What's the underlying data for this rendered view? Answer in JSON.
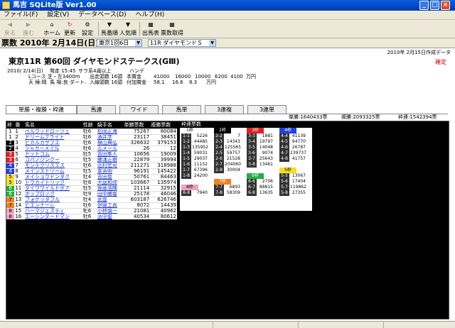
{
  "window": {
    "title": "馬吉 SQLite版 Ver1.00",
    "min": "_",
    "max": "□",
    "close": "×"
  },
  "menu": [
    "ファイル(F)",
    "設定(V)",
    "データベース(D)",
    "ヘルプ(H)"
  ],
  "toolbar": {
    "back": "戻る",
    "forward": "進む",
    "home": "ホーム",
    "refresh": "更新",
    "settings": "設定",
    "sort_horse": "馬番順",
    "sort_pop": "人気順",
    "entry_table": "出馬表",
    "odds": "票数取得"
  },
  "datebar": {
    "label": "票数 2010年 2月14日(日)",
    "venue": "東京1回6日",
    "race": "11R ダイヤモンドＳ"
  },
  "race": {
    "created": "2010年 2月15日作成データ",
    "title": "東京11R 第60回 ダイヤモンドステークス(GⅢ)",
    "status": "確定",
    "info1": [
      "2010/ 2/14(日)",
      "発走 15:45",
      "サラ系4歳以上",
      "ハンデ"
    ],
    "info2": [
      "Lコース 芝・左3400m",
      "出走頭数 16頭",
      "本賞金",
      "41000",
      "16000",
      "10000",
      "6200",
      "4100",
      "万円"
    ],
    "info3": [
      "天 候:晴",
      "馬 場:良",
      "ダート:",
      "入線頭数 16頭",
      "付加賞金",
      "58.1",
      "16.6",
      "8.3",
      "万円"
    ]
  },
  "tabs": [
    "単勝・複勝・枠連",
    "馬連",
    "ワイド",
    "馬単",
    "3連複",
    "3連単"
  ],
  "totals": {
    "tan": "単勝:1640433票",
    "fuku": "複勝:2093325票",
    "waku": "枠連:1542394票"
  },
  "horse_headers": [
    "枠",
    "番",
    "馬名",
    "性齢",
    "騎手名",
    "単勝票数",
    "複勝票数"
  ],
  "horses": [
    {
      "waku": "1",
      "num": "1",
      "name": "ベルウッドローツェ",
      "sex": "牡6",
      "jockey": "松岡正海",
      "tan": "75267",
      "fuku": "80084",
      "color": "#ffffff",
      "fg": "#000"
    },
    {
      "waku": "1",
      "num": "2",
      "name": "ドリームフライト",
      "sex": "牡6",
      "jockey": "酒井学",
      "tan": "23117",
      "fuku": "38451",
      "color": "#ffffff",
      "fg": "#000"
    },
    {
      "waku": "2",
      "num": "3",
      "name": "ヒカルカザブエ",
      "sex": "牡6",
      "jockey": "横山典弘",
      "tan": "326632",
      "fuku": "379153",
      "color": "#000000",
      "fg": "#fff"
    },
    {
      "waku": "2",
      "num": "4",
      "name": "ジャガーメイル",
      "sex": "牡6",
      "jockey": "ルメール",
      "tan": "26",
      "fuku": "12",
      "color": "#000000",
      "fg": "#fff"
    },
    {
      "waku": "3",
      "num": "5",
      "name": "ドットコム",
      "sex": "牡5",
      "jockey": "吉田隼人",
      "tan": "10656",
      "fuku": "19009",
      "color": "#e02020",
      "fg": "#fff"
    },
    {
      "waku": "3",
      "num": "6",
      "name": "コパノジングー",
      "sex": "牡5",
      "jockey": "勝浦正樹",
      "tan": "22879",
      "fuku": "39994",
      "color": "#e02020",
      "fg": "#fff"
    },
    {
      "waku": "4",
      "num": "7",
      "name": "モンテクリスエス",
      "sex": "牡6",
      "jockey": "北村宏司",
      "tan": "211271",
      "fuku": "318988",
      "color": "#2040e0",
      "fg": "#fff"
    },
    {
      "waku": "4",
      "num": "8",
      "name": "メインストリーム",
      "sex": "牡5",
      "jockey": "幸英明",
      "tan": "96191",
      "fuku": "145422",
      "color": "#2040e0",
      "fg": "#fff"
    },
    {
      "waku": "5",
      "num": "9",
      "name": "メイショウドンタク",
      "sex": "牡4",
      "jockey": "吉田豊",
      "tan": "50761",
      "fuku": "84463",
      "color": "#f0e020",
      "fg": "#000"
    },
    {
      "waku": "5",
      "num": "10",
      "name": "トウカイトリック",
      "sex": "牡8",
      "jockey": "大庭和弥",
      "tan": "103667",
      "fuku": "135974",
      "color": "#f0e020",
      "fg": "#000"
    },
    {
      "waku": "6",
      "num": "11",
      "name": "ダイワワイルドボア",
      "sex": "牡5",
      "jockey": "後藤浩輝",
      "tan": "21114",
      "fuku": "32915",
      "color": "#20b040",
      "fg": "#fff"
    },
    {
      "waku": "6",
      "num": "12",
      "name": "ポップロック",
      "sex": "牡9",
      "jockey": "田中勝春",
      "tan": "25178",
      "fuku": "46046",
      "color": "#20b040",
      "fg": "#fff"
    },
    {
      "waku": "7",
      "num": "13",
      "name": "フォゲッタブル",
      "sex": "牡4",
      "jockey": "武豊",
      "tan": "603187",
      "fuku": "626746",
      "color": "#f08020",
      "fg": "#000"
    },
    {
      "waku": "7",
      "num": "14",
      "name": "ビエンナーレ",
      "sex": "牡6",
      "jockey": "伊藤工真",
      "tan": "8072",
      "fuku": "14439",
      "color": "#f08020",
      "fg": "#000"
    },
    {
      "waku": "8",
      "num": "15",
      "name": "ハーマジェスティ",
      "sex": "牝6",
      "jockey": "小林慎一",
      "tan": "21081",
      "fuku": "40962",
      "color": "#f0a0c0",
      "fg": "#000"
    },
    {
      "waku": "8",
      "num": "16",
      "name": "エーシンダードマン",
      "sex": "牡6",
      "jockey": "浜中俊",
      "tan": "40534",
      "fuku": "80612",
      "color": "#f0a0c0",
      "fg": "#000"
    }
  ],
  "waku_header": "枠連票数",
  "waku_pairs": [
    [
      [
        "1枠",
        "",
        ""
      ],
      [
        "2枠",
        "",
        ""
      ],
      [
        "3枠",
        "",
        ""
      ],
      [
        "4枠",
        "",
        ""
      ]
    ],
    [
      [
        "1-1",
        "5226",
        ""
      ],
      [
        "2-2",
        "7",
        ""
      ],
      [
        "3-3",
        "1881",
        ""
      ],
      [
        "4-4",
        "41139",
        ""
      ]
    ],
    [
      [
        "1-2",
        "44485",
        ""
      ],
      [
        "2-3",
        "14343",
        ""
      ],
      [
        "3-4",
        "19797",
        ""
      ],
      [
        "4-5",
        "94770",
        ""
      ]
    ],
    [
      [
        "1-3",
        "135952",
        ""
      ],
      [
        "2-4",
        "125565",
        ""
      ],
      [
        "3-5",
        "14048",
        ""
      ],
      [
        "4-6",
        "26787",
        ""
      ]
    ],
    [
      [
        "1-4",
        "59031",
        ""
      ],
      [
        "2-5",
        "59757",
        ""
      ],
      [
        "3-6",
        "9074",
        ""
      ],
      [
        "4-7",
        "239737",
        ""
      ]
    ],
    [
      [
        "1-5",
        "29037",
        ""
      ],
      [
        "2-6",
        "21528",
        ""
      ],
      [
        "3-7",
        "25643",
        ""
      ],
      [
        "4-8",
        "41757",
        ""
      ]
    ],
    [
      [
        "1-6",
        "11152",
        ""
      ],
      [
        "2-7",
        "204060",
        ""
      ],
      [
        "3-8",
        "13461",
        ""
      ],
      [
        "",
        "",
        ""
      ]
    ],
    [
      [
        "1-7",
        "67396",
        ""
      ],
      [
        "2-8",
        "30004",
        ""
      ],
      [
        "",
        "",
        ""
      ],
      [
        "5枠",
        "",
        ""
      ]
    ],
    [
      [
        "1-8",
        "24200",
        ""
      ],
      [
        "",
        "",
        ""
      ],
      [
        "6枠",
        "",
        ""
      ],
      [
        "5-5",
        "13067",
        ""
      ]
    ],
    [
      [
        "",
        "",
        ""
      ],
      [
        "7枠",
        "",
        ""
      ],
      [
        "6-6",
        "2706",
        ""
      ],
      [
        "5-6",
        "17404",
        ""
      ]
    ],
    [
      [
        "8枠",
        "",
        ""
      ],
      [
        "7-7",
        "6893",
        ""
      ],
      [
        "6-7",
        "88815",
        ""
      ],
      [
        "5-7",
        "119862",
        ""
      ]
    ],
    [
      [
        "8-8",
        "7940",
        ""
      ],
      [
        "7-8",
        "58309",
        ""
      ],
      [
        "6-8",
        "13635",
        ""
      ],
      [
        "5-8",
        "27355",
        ""
      ]
    ]
  ]
}
